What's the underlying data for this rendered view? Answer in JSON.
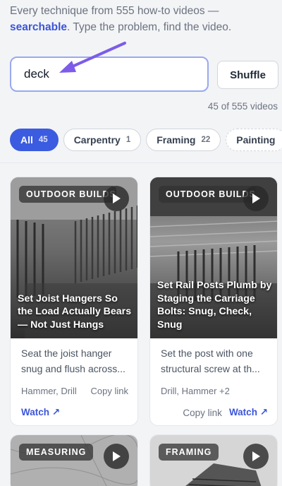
{
  "intro": {
    "line1": "Every technique from 555 how-to videos —",
    "highlight": "searchable",
    "rest": ". Type the problem, find the video."
  },
  "search": {
    "value": "deck",
    "placeholder": ""
  },
  "shuffle_label": "Shuffle",
  "results_count": "45 of 555 videos",
  "filters": [
    {
      "label": "All",
      "count": "45",
      "active": true
    },
    {
      "label": "Carpentry",
      "count": "1"
    },
    {
      "label": "Framing",
      "count": "22"
    },
    {
      "label": "Painting",
      "count": ""
    }
  ],
  "cards": [
    {
      "category": "OUTDOOR BUILDS",
      "title": "Set Joist Hangers So the Load Actually Bears — Not Just Hangs",
      "description": "Seat the joist hanger snug and flush across...",
      "tools": "Hammer, Drill",
      "copy_label": "Copy link",
      "watch_label": "Watch ↗"
    },
    {
      "category": "OUTDOOR BUILDS",
      "title": "Set Rail Posts Plumb by Staging the Carriage Bolts: Snug, Check, Snug",
      "description": "Set the post with one structural screw at th...",
      "tools": "Drill, Hammer +2",
      "copy_label": "Copy link",
      "watch_label": "Watch ↗"
    },
    {
      "category": "MEASURING"
    },
    {
      "category": "FRAMING"
    }
  ],
  "colors": {
    "accent": "#3b5ce0",
    "link": "#3b55d9",
    "annotation_arrow": "#7c5ce8"
  },
  "icons": {
    "play": "play-icon",
    "watch": "external-arrow-icon"
  }
}
